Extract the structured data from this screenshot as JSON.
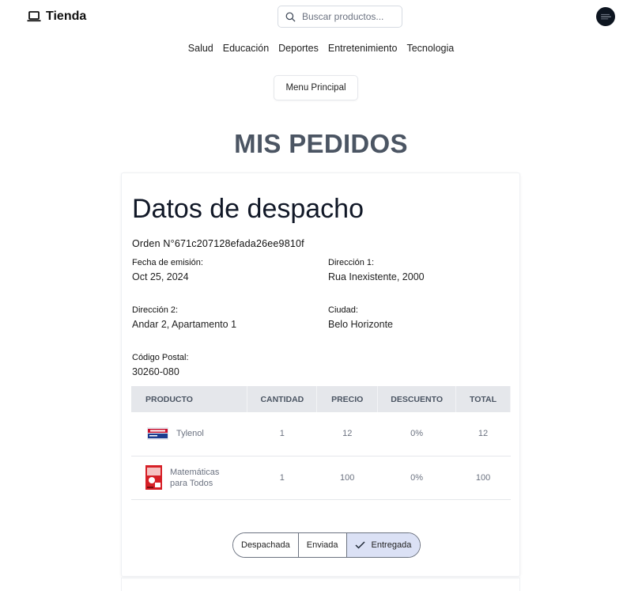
{
  "header": {
    "brand": "Tienda",
    "search_placeholder": "Buscar productos..."
  },
  "categories": [
    "Salud",
    "Educación",
    "Deportes",
    "Entretenimiento",
    "Tecnologia"
  ],
  "menu_button": "Menu Principal",
  "page_title": "MIS PEDIDOS",
  "order": {
    "heading": "Datos de despacho",
    "number": "Orden N°671c207128efada26ee9810f",
    "fields": {
      "fecha_label": "Fecha de emisión:",
      "fecha_value": "Oct 25, 2024",
      "dir1_label": "Dirección 1:",
      "dir1_value": "Rua Inexistente, 2000",
      "dir2_label": "Dirección 2:",
      "dir2_value": "Andar 2, Apartamento 1",
      "ciudad_label": "Ciudad:",
      "ciudad_value": "Belo Horizonte",
      "postal_label": "Código Postal:",
      "postal_value": "30260-080"
    },
    "table": {
      "headers": [
        "PRODUCTO",
        "CANTIDAD",
        "PRECIO",
        "DESCUENTO",
        "TOTAL"
      ],
      "rows": [
        {
          "product": "Tylenol",
          "cantidad": "1",
          "precio": "12",
          "descuento": "0%",
          "total": "12"
        },
        {
          "product": "Matemáticas para Todos",
          "cantidad": "1",
          "precio": "100",
          "descuento": "0%",
          "total": "100"
        }
      ]
    },
    "status_steps": [
      "Despachada",
      "Enviada",
      "Entregada"
    ],
    "active_status": "Entregada"
  }
}
